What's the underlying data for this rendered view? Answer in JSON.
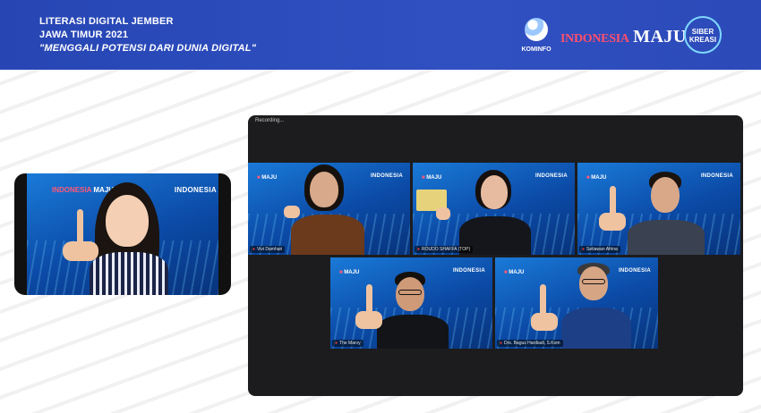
{
  "header": {
    "line1": "LITERASI DIGITAL JEMBER",
    "line2": "JAWA TIMUR 2021",
    "line3": "\"MENGGALI POTENSI DARI DUNIA DIGITAL\"",
    "kominfo_label": "KOMINFO",
    "indonesia_logo": "INDONESIA",
    "maju_logo": "MAJU",
    "siber_logo_line1": "SIBER",
    "siber_logo_line2": "KREASI"
  },
  "solo_video": {
    "brand": "INDONESIA",
    "logo_left": "INDONESIA",
    "logo_right": "MAJU"
  },
  "zoom_window": {
    "title": "Recording...",
    "participants": [
      {
        "name": "Vivi Damhari",
        "brand": "INDONESIA",
        "logo": "MAJU"
      },
      {
        "name": "ROUDO SHAFFA (TOP)",
        "brand": "INDONESIA",
        "logo": "MAJU"
      },
      {
        "name": "Setiawan Afrina",
        "brand": "INDONESIA",
        "logo": "MAJU"
      },
      {
        "name": "The Marvy",
        "brand": "INDONESIA",
        "logo": "MAJU"
      },
      {
        "name": "Drs. Bagus Hardiadi, S.Kom",
        "brand": "INDONESIA",
        "logo": "MAJU"
      }
    ]
  },
  "colors": {
    "banner": "#2c4ab8",
    "accent_red": "#ff4f6b",
    "zoom_bg": "#1c1c1e"
  }
}
